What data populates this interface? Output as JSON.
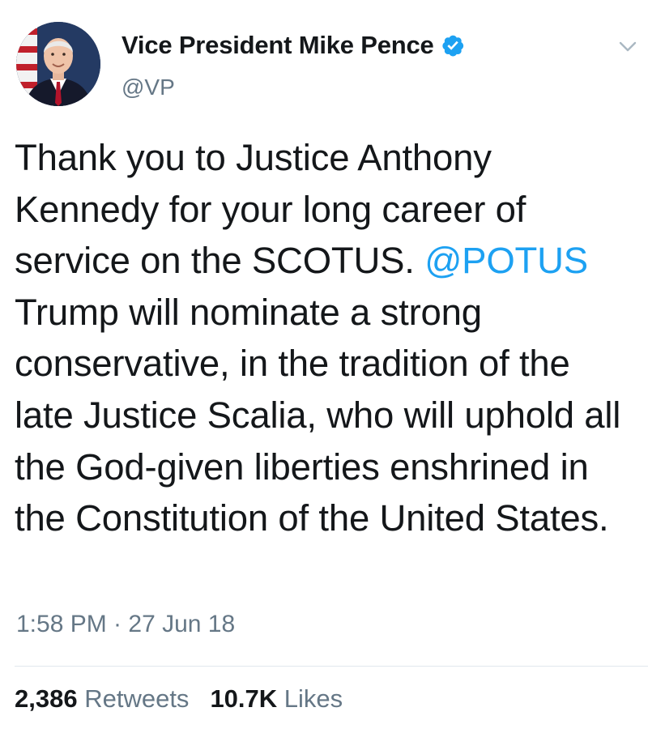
{
  "tweet": {
    "author": {
      "display_name": "Vice President Mike Pence",
      "handle": "@VP",
      "verified": true,
      "avatar_icon": "profile-photo"
    },
    "text": {
      "before_mention": "Thank you to Justice Anthony Kennedy for your long career of service on the SCOTUS. ",
      "mention": "@POTUS",
      "after_mention": " Trump will nominate a strong conservative, in the tradition of the late Justice Scalia, who will uphold all the God-given liberties enshrined in the Constitution of the United States."
    },
    "timestamp": "1:58 PM · 27 Jun 18",
    "stats": {
      "retweets_count": "2,386",
      "retweets_label": "Retweets",
      "likes_count": "10.7K",
      "likes_label": "Likes"
    },
    "menu_icon": "chevron-down-icon"
  },
  "colors": {
    "text": "#14171a",
    "secondary": "#657786",
    "link": "#1da1f2",
    "verified": "#1da1f2",
    "divider": "#e1e8ed"
  }
}
